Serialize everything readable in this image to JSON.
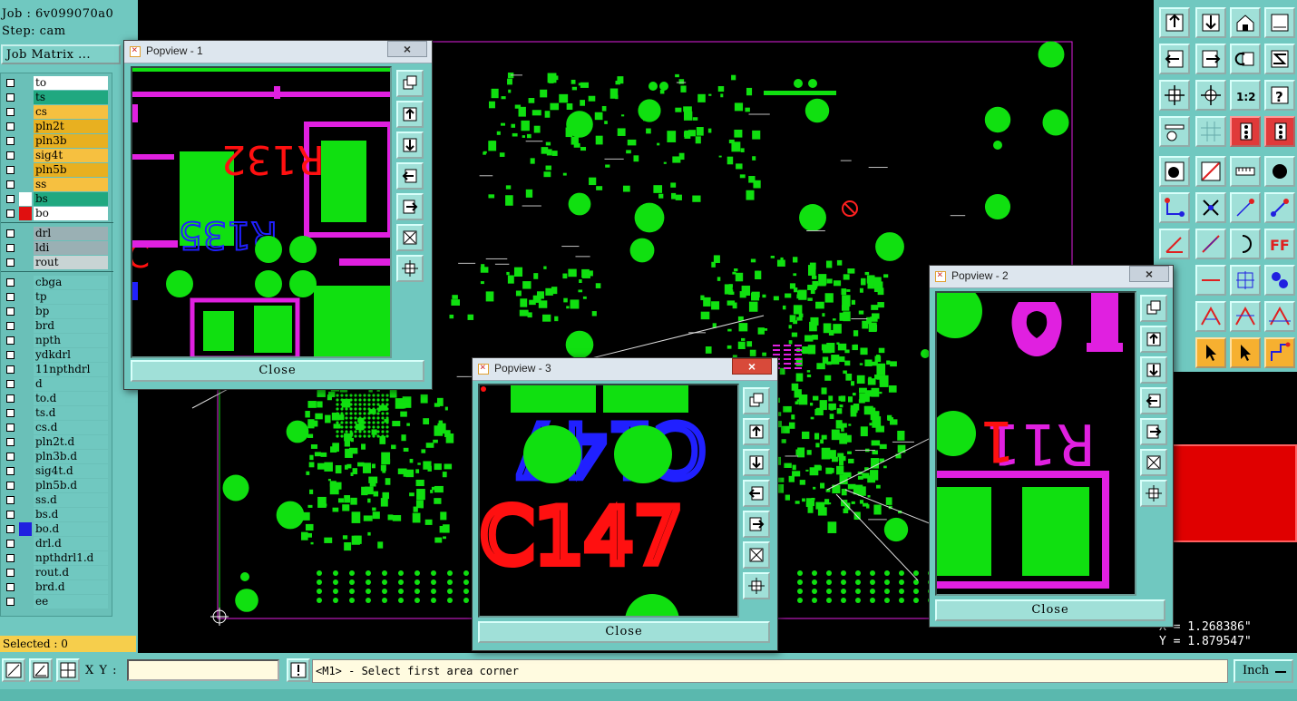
{
  "header": {
    "job_line": "Job : 6v099070a0",
    "step_line": "Step: cam"
  },
  "job_matrix_label": "Job Matrix ...",
  "layers": [
    {
      "name": "to",
      "color": "#ffffff",
      "swatch": ""
    },
    {
      "name": "ts",
      "color": "#20a880",
      "swatch": ""
    },
    {
      "name": "cs",
      "color": "#f6c040",
      "swatch": ""
    },
    {
      "name": "pln2t",
      "color": "#e8b020",
      "swatch": ""
    },
    {
      "name": "pln3b",
      "color": "#e8b020",
      "swatch": ""
    },
    {
      "name": "sig4t",
      "color": "#f6c040",
      "swatch": ""
    },
    {
      "name": "pln5b",
      "color": "#e8b020",
      "swatch": ""
    },
    {
      "name": "ss",
      "color": "#f6c040",
      "swatch": ""
    },
    {
      "name": "bs",
      "color": "#20a880",
      "swatch": "#ffffff"
    },
    {
      "name": "bo",
      "color": "#ffffff",
      "swatch": "#e01010"
    },
    {
      "name": "drl",
      "color": "#9ab0b4",
      "swatch": ""
    },
    {
      "name": "ldi",
      "color": "#9ab0b4",
      "swatch": ""
    },
    {
      "name": "rout",
      "color": "#c8d4d4",
      "swatch": ""
    },
    {
      "name": "cbga",
      "color": "#70c8c0",
      "swatch": ""
    },
    {
      "name": "tp",
      "color": "#70c8c0",
      "swatch": ""
    },
    {
      "name": "bp",
      "color": "#70c8c0",
      "swatch": ""
    },
    {
      "name": "brd",
      "color": "#70c8c0",
      "swatch": ""
    },
    {
      "name": "npth",
      "color": "#70c8c0",
      "swatch": ""
    },
    {
      "name": "ydkdrl",
      "color": "#70c8c0",
      "swatch": ""
    },
    {
      "name": "11npthdrl",
      "color": "#70c8c0",
      "swatch": ""
    },
    {
      "name": "d",
      "color": "#70c8c0",
      "swatch": ""
    },
    {
      "name": "to.d",
      "color": "#70c8c0",
      "swatch": ""
    },
    {
      "name": "ts.d",
      "color": "#70c8c0",
      "swatch": ""
    },
    {
      "name": "cs.d",
      "color": "#70c8c0",
      "swatch": ""
    },
    {
      "name": "pln2t.d",
      "color": "#70c8c0",
      "swatch": ""
    },
    {
      "name": "pln3b.d",
      "color": "#70c8c0",
      "swatch": ""
    },
    {
      "name": "sig4t.d",
      "color": "#70c8c0",
      "swatch": ""
    },
    {
      "name": "pln5b.d",
      "color": "#70c8c0",
      "swatch": ""
    },
    {
      "name": "ss.d",
      "color": "#70c8c0",
      "swatch": ""
    },
    {
      "name": "bs.d",
      "color": "#70c8c0",
      "swatch": ""
    },
    {
      "name": "bo.d",
      "color": "#70c8c0",
      "swatch": "#2020e0"
    },
    {
      "name": "drl.d",
      "color": "#70c8c0",
      "swatch": ""
    },
    {
      "name": "npthdrl1.d",
      "color": "#70c8c0",
      "swatch": ""
    },
    {
      "name": "rout.d",
      "color": "#70c8c0",
      "swatch": ""
    },
    {
      "name": "brd.d",
      "color": "#70c8c0",
      "swatch": ""
    },
    {
      "name": "ee",
      "color": "#70c8c0",
      "swatch": ""
    }
  ],
  "selected_label": "Selected : 0",
  "coords": {
    "x": "X = 1.268386\"",
    "y": "Y = 1.879547\""
  },
  "xy_label": "X Y :",
  "xy_value": "",
  "status_message": "<M1> - Select first area corner",
  "units": {
    "label": "Inch",
    "icon": "dropdown-dash-icon"
  },
  "popviews": [
    {
      "title": "Popview - 1",
      "close_x": "×",
      "close_label": "Close"
    },
    {
      "title": "Popview - 2",
      "close_x": "×",
      "close_label": "Close"
    },
    {
      "title": "Popview - 3",
      "close_x": "×",
      "close_label": "Close"
    }
  ],
  "pv_labels": {
    "pv1_ref": "R132",
    "pv1_ref2": "R135",
    "pv1_frag": "C",
    "pv2_ref": "R11",
    "pv2_ref_red": "1",
    "pv3_top": "C147",
    "pv3_bottom": "C147"
  },
  "colors": {
    "pad": "#10e010",
    "silk": "#e020e0",
    "red": "#ff1010",
    "blue": "#2020ff",
    "panel": "#70c8c0"
  }
}
